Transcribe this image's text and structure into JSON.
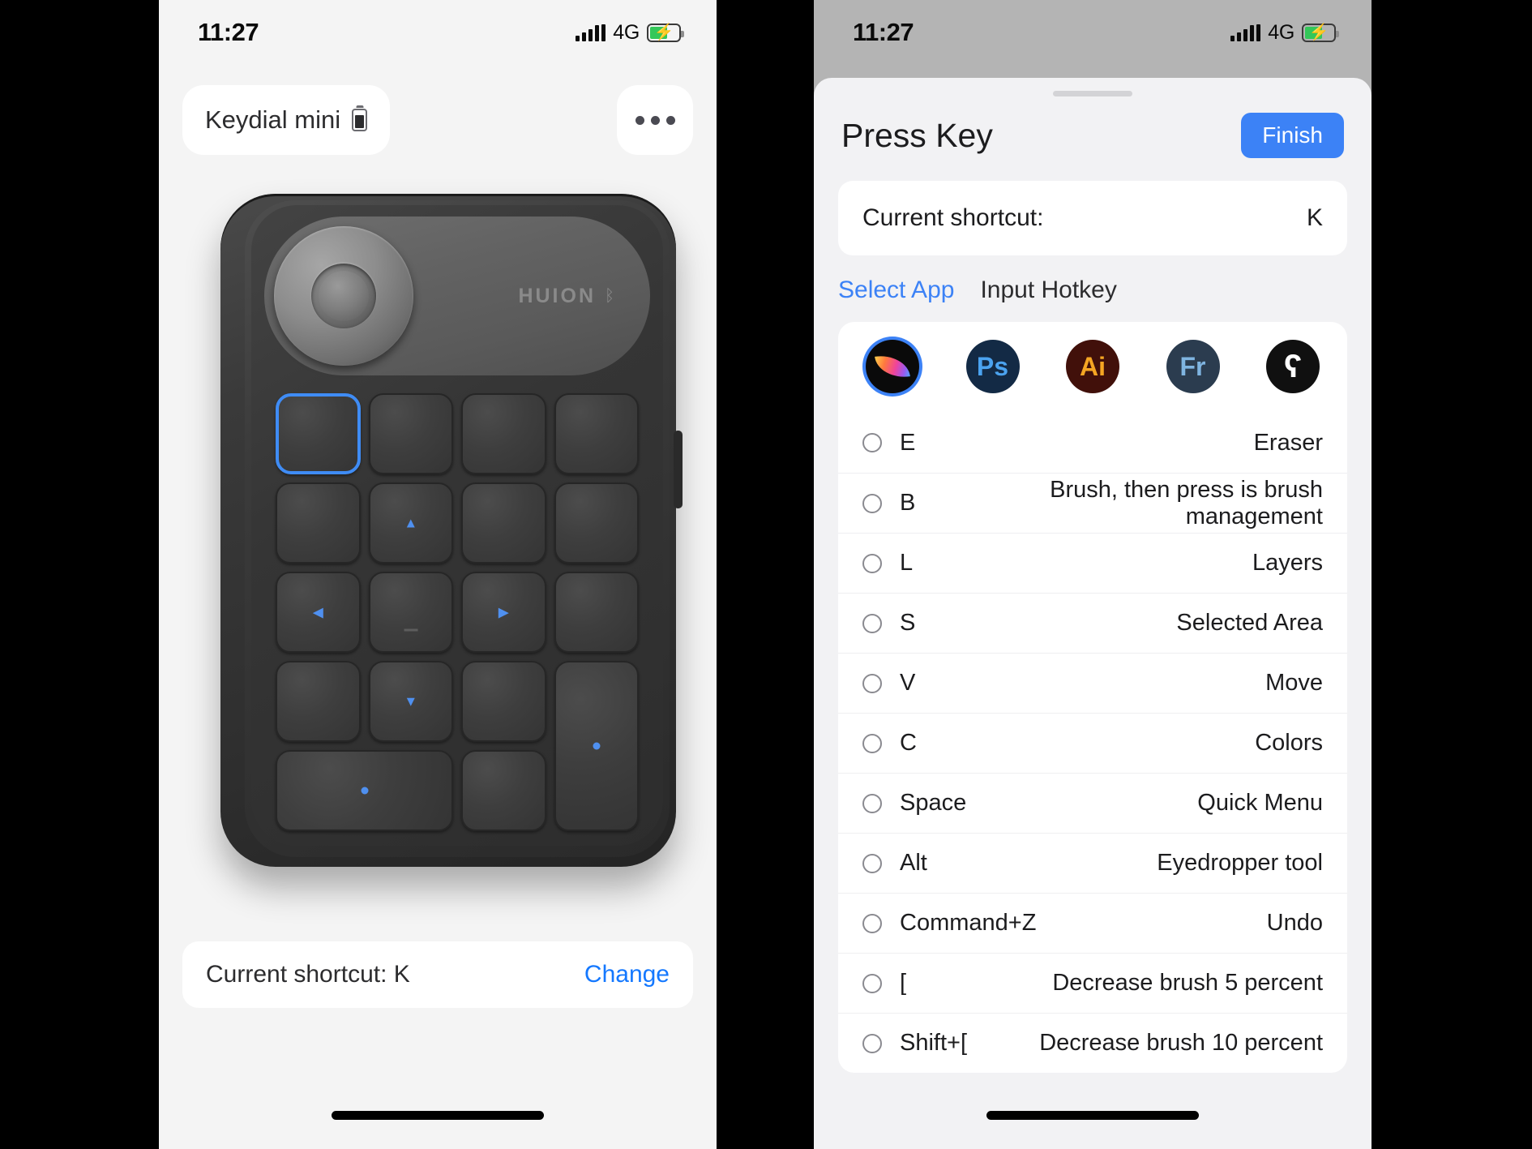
{
  "status_bar": {
    "time": "11:27",
    "network": "4G",
    "signal_icon": "signal-bars-icon",
    "battery_icon": "battery-charging-icon"
  },
  "left_phone": {
    "device_chip": {
      "name": "Keydial mini",
      "battery_icon": "device-battery-icon"
    },
    "more_button": {
      "icon": "more-horizontal-icon"
    },
    "device_image": {
      "brand": "HUION",
      "bluetooth_icon": "bluetooth-icon",
      "dial_name": "rotary-dial",
      "keys": [
        {
          "id": "k1",
          "glyph": "",
          "selected": true,
          "span": "1x1"
        },
        {
          "id": "k2",
          "glyph": "",
          "selected": false,
          "span": "1x1"
        },
        {
          "id": "k3",
          "glyph": "",
          "selected": false,
          "span": "1x1"
        },
        {
          "id": "k4",
          "glyph": "",
          "selected": false,
          "span": "1x1"
        },
        {
          "id": "k5",
          "glyph": "",
          "selected": false,
          "span": "1x1"
        },
        {
          "id": "k6",
          "glyph": "▲",
          "selected": false,
          "span": "1x1"
        },
        {
          "id": "k7",
          "glyph": "",
          "selected": false,
          "span": "1x1"
        },
        {
          "id": "k8",
          "glyph": "",
          "selected": false,
          "span": "1x1"
        },
        {
          "id": "k9",
          "glyph": "◀",
          "selected": false,
          "span": "1x1"
        },
        {
          "id": "k10",
          "glyph": "—",
          "selected": false,
          "span": "1x1"
        },
        {
          "id": "k11",
          "glyph": "▶",
          "selected": false,
          "span": "1x1"
        },
        {
          "id": "k12",
          "glyph": "",
          "selected": false,
          "span": "1x1"
        },
        {
          "id": "k13",
          "glyph": "",
          "selected": false,
          "span": "1x1"
        },
        {
          "id": "k14",
          "glyph": "▼",
          "selected": false,
          "span": "1x1"
        },
        {
          "id": "k15",
          "glyph": "",
          "selected": false,
          "span": "1x1"
        },
        {
          "id": "k16",
          "glyph": "•",
          "selected": false,
          "span": "1x2"
        },
        {
          "id": "k17",
          "glyph": "•",
          "selected": false,
          "span": "2x1"
        },
        {
          "id": "k18",
          "glyph": "",
          "selected": false,
          "span": "1x1"
        }
      ]
    },
    "shortcut_bar": {
      "label": "Current shortcut: K",
      "change_label": "Change"
    }
  },
  "right_phone": {
    "sheet": {
      "title": "Press Key",
      "finish_label": "Finish",
      "current_shortcut_label": "Current shortcut:",
      "current_shortcut_value": "K",
      "tabs": [
        {
          "label": "Select App",
          "active": true
        },
        {
          "label": "Input Hotkey",
          "active": false
        }
      ],
      "apps": [
        {
          "name": "Procreate",
          "icon": "procreate-icon",
          "abbr": "",
          "bg": "#0a0a0a",
          "fg": "#ffffff",
          "selected": true
        },
        {
          "name": "Adobe Photoshop",
          "icon": "photoshop-icon",
          "abbr": "Ps",
          "bg": "#132a45",
          "fg": "#4ba3f0",
          "selected": false
        },
        {
          "name": "Adobe Illustrator",
          "icon": "illustrator-icon",
          "abbr": "Ai",
          "bg": "#41100a",
          "fg": "#f5a623",
          "selected": false
        },
        {
          "name": "Adobe Fresco",
          "icon": "fresco-icon",
          "abbr": "Fr",
          "bg": "#2b3c4f",
          "fg": "#7fb4e0",
          "selected": false
        },
        {
          "name": "Clip Studio Paint",
          "icon": "clipstudio-icon",
          "abbr": "",
          "bg": "#101010",
          "fg": "#ffffff",
          "selected": false
        }
      ],
      "shortcut_rows": [
        {
          "key": "E",
          "description": "Eraser"
        },
        {
          "key": "B",
          "description": "Brush, then press is brush management"
        },
        {
          "key": "L",
          "description": "Layers"
        },
        {
          "key": "S",
          "description": "Selected Area"
        },
        {
          "key": "V",
          "description": "Move"
        },
        {
          "key": "C",
          "description": "Colors"
        },
        {
          "key": "Space",
          "description": "Quick Menu"
        },
        {
          "key": "Alt",
          "description": "Eyedropper tool"
        },
        {
          "key": "Command+Z",
          "description": "Undo"
        },
        {
          "key": "[",
          "description": "Decrease brush 5 percent"
        },
        {
          "key": "Shift+[",
          "description": "Decrease brush 10 percent"
        }
      ]
    }
  },
  "colors": {
    "accent_blue": "#3c82f6",
    "link_blue": "#1478ff",
    "battery_green": "#34c759",
    "sheet_bg": "#f2f2f4",
    "dim_overlay": "#b4b4b4"
  }
}
